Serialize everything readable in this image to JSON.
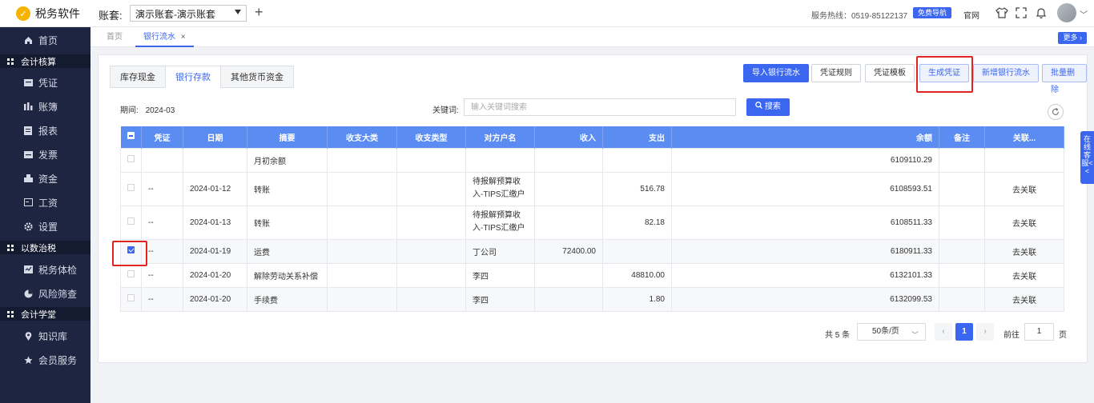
{
  "app": {
    "name": "税务软件",
    "logo_char": "✓"
  },
  "header": {
    "account_label": "账套:",
    "account_value": "演示账套-演示账套",
    "hotline": "服务热线：0519-85122137",
    "guide_label": "免费导航",
    "site_label": "官网"
  },
  "sidebar": {
    "items": [
      {
        "label": "首页",
        "icon": "home-icon"
      },
      {
        "label": "会计核算",
        "type": "section"
      },
      {
        "label": "凭证",
        "icon": "voucher-icon"
      },
      {
        "label": "账簿",
        "icon": "ledger-icon"
      },
      {
        "label": "报表",
        "icon": "report-icon"
      },
      {
        "label": "发票",
        "icon": "invoice-icon"
      },
      {
        "label": "资金",
        "icon": "funds-icon"
      },
      {
        "label": "工资",
        "icon": "salary-icon"
      },
      {
        "label": "设置",
        "icon": "settings-icon"
      },
      {
        "label": "以数治税",
        "type": "section"
      },
      {
        "label": "税务体检",
        "icon": "tax-check-icon"
      },
      {
        "label": "风险筛查",
        "icon": "risk-icon"
      },
      {
        "label": "会计学堂",
        "type": "section"
      },
      {
        "label": "知识库",
        "icon": "location-icon"
      },
      {
        "label": "会员服务",
        "icon": "star-icon"
      }
    ]
  },
  "page_tabs": [
    {
      "label": "首页"
    },
    {
      "label": "银行流水",
      "close": "×"
    }
  ],
  "more_label": "更多",
  "inner_tabs": [
    "库存现金",
    "银行存款",
    "其他货币资金"
  ],
  "actions": {
    "import": "导入银行流水",
    "rules": "凭证规则",
    "template": "凭证模板",
    "generate": "生成凭证",
    "add": "新增银行流水",
    "batch_delete": "批量删除"
  },
  "filters": {
    "period_label": "期间:",
    "period_value": "2024-03",
    "keyword_label": "关键词:",
    "keyword_placeholder": "输入关键词搜索",
    "search_label": "搜索"
  },
  "table": {
    "columns": [
      "凭证",
      "日期",
      "摘要",
      "收支大类",
      "收支类型",
      "对方户名",
      "收入",
      "支出",
      "余额",
      "备注",
      "关联..."
    ],
    "rows": [
      {
        "voucher": "",
        "date": "",
        "summary": "月初余额",
        "category": "",
        "type": "",
        "counterparty": "",
        "income": "",
        "expense": "",
        "balance": "6109110.29",
        "note": "",
        "link": "",
        "checked": false
      },
      {
        "voucher": "--",
        "date": "2024-01-12",
        "summary": "转账",
        "category": "",
        "type": "",
        "counterparty": "待报解预算收入-TIPS汇缴户",
        "income": "",
        "expense": "516.78",
        "balance": "6108593.51",
        "note": "",
        "link": "去关联",
        "checked": false
      },
      {
        "voucher": "--",
        "date": "2024-01-13",
        "summary": "转账",
        "category": "",
        "type": "",
        "counterparty": "待报解预算收入-TIPS汇缴户",
        "income": "",
        "expense": "82.18",
        "balance": "6108511.33",
        "note": "",
        "link": "去关联",
        "checked": false
      },
      {
        "voucher": "--",
        "date": "2024-01-19",
        "summary": "运费",
        "category": "",
        "type": "",
        "counterparty": "丁公司",
        "income": "72400.00",
        "expense": "",
        "balance": "6180911.33",
        "note": "",
        "link": "去关联",
        "checked": true
      },
      {
        "voucher": "--",
        "date": "2024-01-20",
        "summary": "解除劳动关系补偿",
        "category": "",
        "type": "",
        "counterparty": "李四",
        "income": "",
        "expense": "48810.00",
        "balance": "6132101.33",
        "note": "",
        "link": "去关联",
        "checked": false
      },
      {
        "voucher": "--",
        "date": "2024-01-20",
        "summary": "手续费",
        "category": "",
        "type": "",
        "counterparty": "李四",
        "income": "",
        "expense": "1.80",
        "balance": "6132099.53",
        "note": "",
        "link": "去关联",
        "checked": false
      }
    ]
  },
  "pagination": {
    "total": "共 5 条",
    "page_size": "50条/页",
    "prev": "‹",
    "current": "1",
    "next": "›",
    "goto_label": "前往",
    "goto_value": "1",
    "goto_unit": "页"
  },
  "float_service": "在线客服<<",
  "colors": {
    "accent": "#3a66f0",
    "header_bg": "#5b8cf2",
    "sidebar_bg": "#1e2541",
    "highlight": "#e02424"
  }
}
